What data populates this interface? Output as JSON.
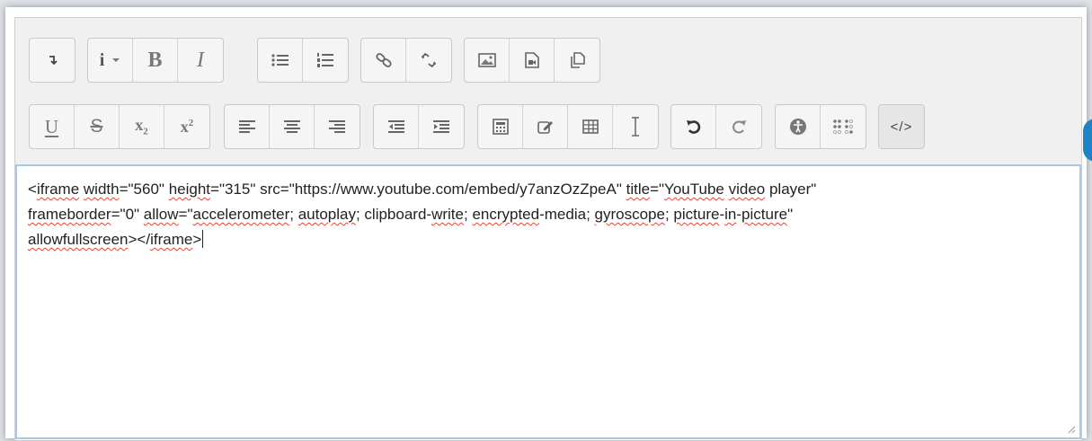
{
  "toolbar": {
    "row1": [
      {
        "buttons": [
          {
            "name": "collapse-toolbar-button",
            "icon": "collapse-icon"
          }
        ]
      },
      {
        "buttons": [
          {
            "name": "info-dropdown-button",
            "icon": "info-icon"
          },
          {
            "name": "bold-button",
            "icon": "bold-icon",
            "label": "B"
          },
          {
            "name": "italic-button",
            "icon": "italic-icon",
            "label": "I"
          }
        ]
      },
      {
        "buttons": [
          {
            "name": "unordered-list-button",
            "icon": "bulleted-list-icon"
          },
          {
            "name": "ordered-list-button",
            "icon": "numbered-list-icon"
          }
        ]
      },
      {
        "buttons": [
          {
            "name": "insert-link-button",
            "icon": "link-icon"
          },
          {
            "name": "unlink-button",
            "icon": "unlink-icon"
          }
        ]
      },
      {
        "buttons": [
          {
            "name": "insert-image-button",
            "icon": "image-icon"
          },
          {
            "name": "insert-media-button",
            "icon": "media-icon"
          },
          {
            "name": "manage-files-button",
            "icon": "files-icon"
          }
        ]
      }
    ],
    "row2": [
      {
        "buttons": [
          {
            "name": "underline-button",
            "icon": "underline-icon",
            "label": "U"
          },
          {
            "name": "strikethrough-button",
            "icon": "strikethrough-icon",
            "label": "S"
          },
          {
            "name": "subscript-button",
            "icon": "subscript-icon",
            "label": "x",
            "sub": "2"
          },
          {
            "name": "superscript-button",
            "icon": "superscript-icon",
            "label": "x",
            "sup": "2"
          }
        ]
      },
      {
        "buttons": [
          {
            "name": "align-left-button",
            "icon": "align-left-icon"
          },
          {
            "name": "align-center-button",
            "icon": "align-center-icon"
          },
          {
            "name": "align-right-button",
            "icon": "align-right-icon"
          }
        ]
      },
      {
        "buttons": [
          {
            "name": "outdent-button",
            "icon": "outdent-icon"
          },
          {
            "name": "indent-button",
            "icon": "indent-icon"
          }
        ]
      },
      {
        "buttons": [
          {
            "name": "equation-button",
            "icon": "calculator-icon"
          },
          {
            "name": "special-character-button",
            "icon": "edit-icon"
          },
          {
            "name": "table-button",
            "icon": "table-icon"
          },
          {
            "name": "clear-formatting-button",
            "icon": "text-cursor-icon"
          }
        ]
      },
      {
        "buttons": [
          {
            "name": "undo-button",
            "icon": "undo-icon"
          },
          {
            "name": "redo-button",
            "icon": "redo-icon"
          }
        ]
      },
      {
        "buttons": [
          {
            "name": "accessibility-checker-button",
            "icon": "accessibility-icon"
          },
          {
            "name": "screenreader-helper-button",
            "icon": "braille-icon"
          }
        ]
      },
      {
        "buttons": [
          {
            "name": "html-source-button",
            "icon": "code-icon",
            "label": "</>",
            "active": true
          }
        ]
      }
    ]
  },
  "editor": {
    "lines": [
      [
        {
          "t": "<"
        },
        {
          "t": "iframe",
          "sp": true
        },
        {
          "t": " "
        },
        {
          "t": "width",
          "sp": true
        },
        {
          "t": "=\"560\" "
        },
        {
          "t": "height",
          "sp": true
        },
        {
          "t": "=\"315\" src=\"https://www.youtube.com/embed/y7anzOzZpeA\" "
        },
        {
          "t": "title",
          "sp": true
        },
        {
          "t": "=\""
        },
        {
          "t": "YouTube",
          "sp": true
        },
        {
          "t": " "
        },
        {
          "t": "video",
          "sp": true
        },
        {
          "t": " player\""
        }
      ],
      [
        {
          "t": "frameborder",
          "sp": true
        },
        {
          "t": "=\"0\" "
        },
        {
          "t": "allow",
          "sp": true
        },
        {
          "t": "=\""
        },
        {
          "t": "accelerometer",
          "sp": true
        },
        {
          "t": "; "
        },
        {
          "t": "autoplay",
          "sp": true
        },
        {
          "t": "; clipboard-"
        },
        {
          "t": "write",
          "sp": true
        },
        {
          "t": "; "
        },
        {
          "t": "encrypted",
          "sp": true
        },
        {
          "t": "-media; "
        },
        {
          "t": "gyroscope",
          "sp": true
        },
        {
          "t": "; "
        },
        {
          "t": "picture",
          "sp": true
        },
        {
          "t": "-"
        },
        {
          "t": "in",
          "sp": true
        },
        {
          "t": "-"
        },
        {
          "t": "picture",
          "sp": true
        },
        {
          "t": "\""
        }
      ],
      [
        {
          "t": "allowfullscreen",
          "sp": true
        },
        {
          "t": "></"
        },
        {
          "t": "iframe",
          "sp": true
        },
        {
          "t": ">"
        }
      ]
    ]
  },
  "colors": {
    "accent": "#1f84c6",
    "spell_error": "#e0443a",
    "focus_border": "#a8c8e8"
  }
}
